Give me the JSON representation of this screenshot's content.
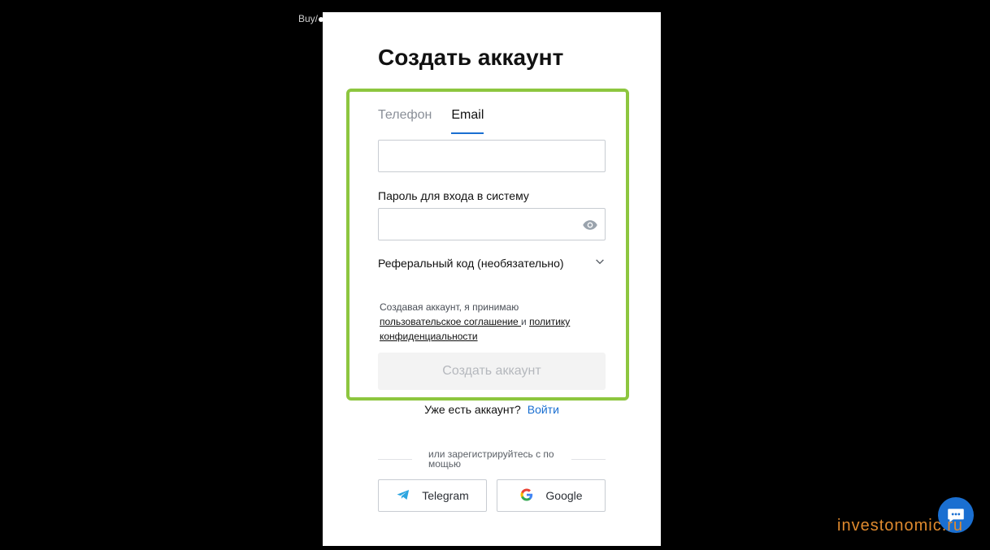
{
  "background": {
    "crumb_text": "Buy/"
  },
  "modal": {
    "title": "Создать аккаунт",
    "tabs": [
      {
        "label": "Телефон",
        "active": false
      },
      {
        "label": "Email",
        "active": true
      }
    ],
    "email_input": {
      "value": "",
      "placeholder": ""
    },
    "password_label": "Пароль для входа в систему",
    "password_input": {
      "value": "",
      "placeholder": ""
    },
    "password_toggle_icon": "eye-icon",
    "referral_label": "Реферальный код (необязательно)",
    "referral_icon": "chevron-down-icon",
    "agreement": {
      "prefix": "Создавая аккаунт, я принимаю",
      "user_agreement_link": "пользовательское соглашение ",
      "conjunction": "и",
      "privacy_link_part1": "политику",
      "privacy_link_part2": "конфиденциальности"
    },
    "submit_label": "Создать аккаунт",
    "have_account_text": "Уже есть аккаунт?",
    "login_link": "Войти",
    "or_register_text": "или зарегистрируйтесь с помощью",
    "social": [
      {
        "label": "Telegram",
        "icon": "telegram-icon"
      },
      {
        "label": "Google",
        "icon": "google-icon"
      }
    ]
  },
  "chat_icon": "chat-bubble-icon",
  "watermark": "investonomic.ru",
  "colors": {
    "highlight": "#8dc63f",
    "accent": "#1a6fd1",
    "watermark": "#e08a2e"
  }
}
